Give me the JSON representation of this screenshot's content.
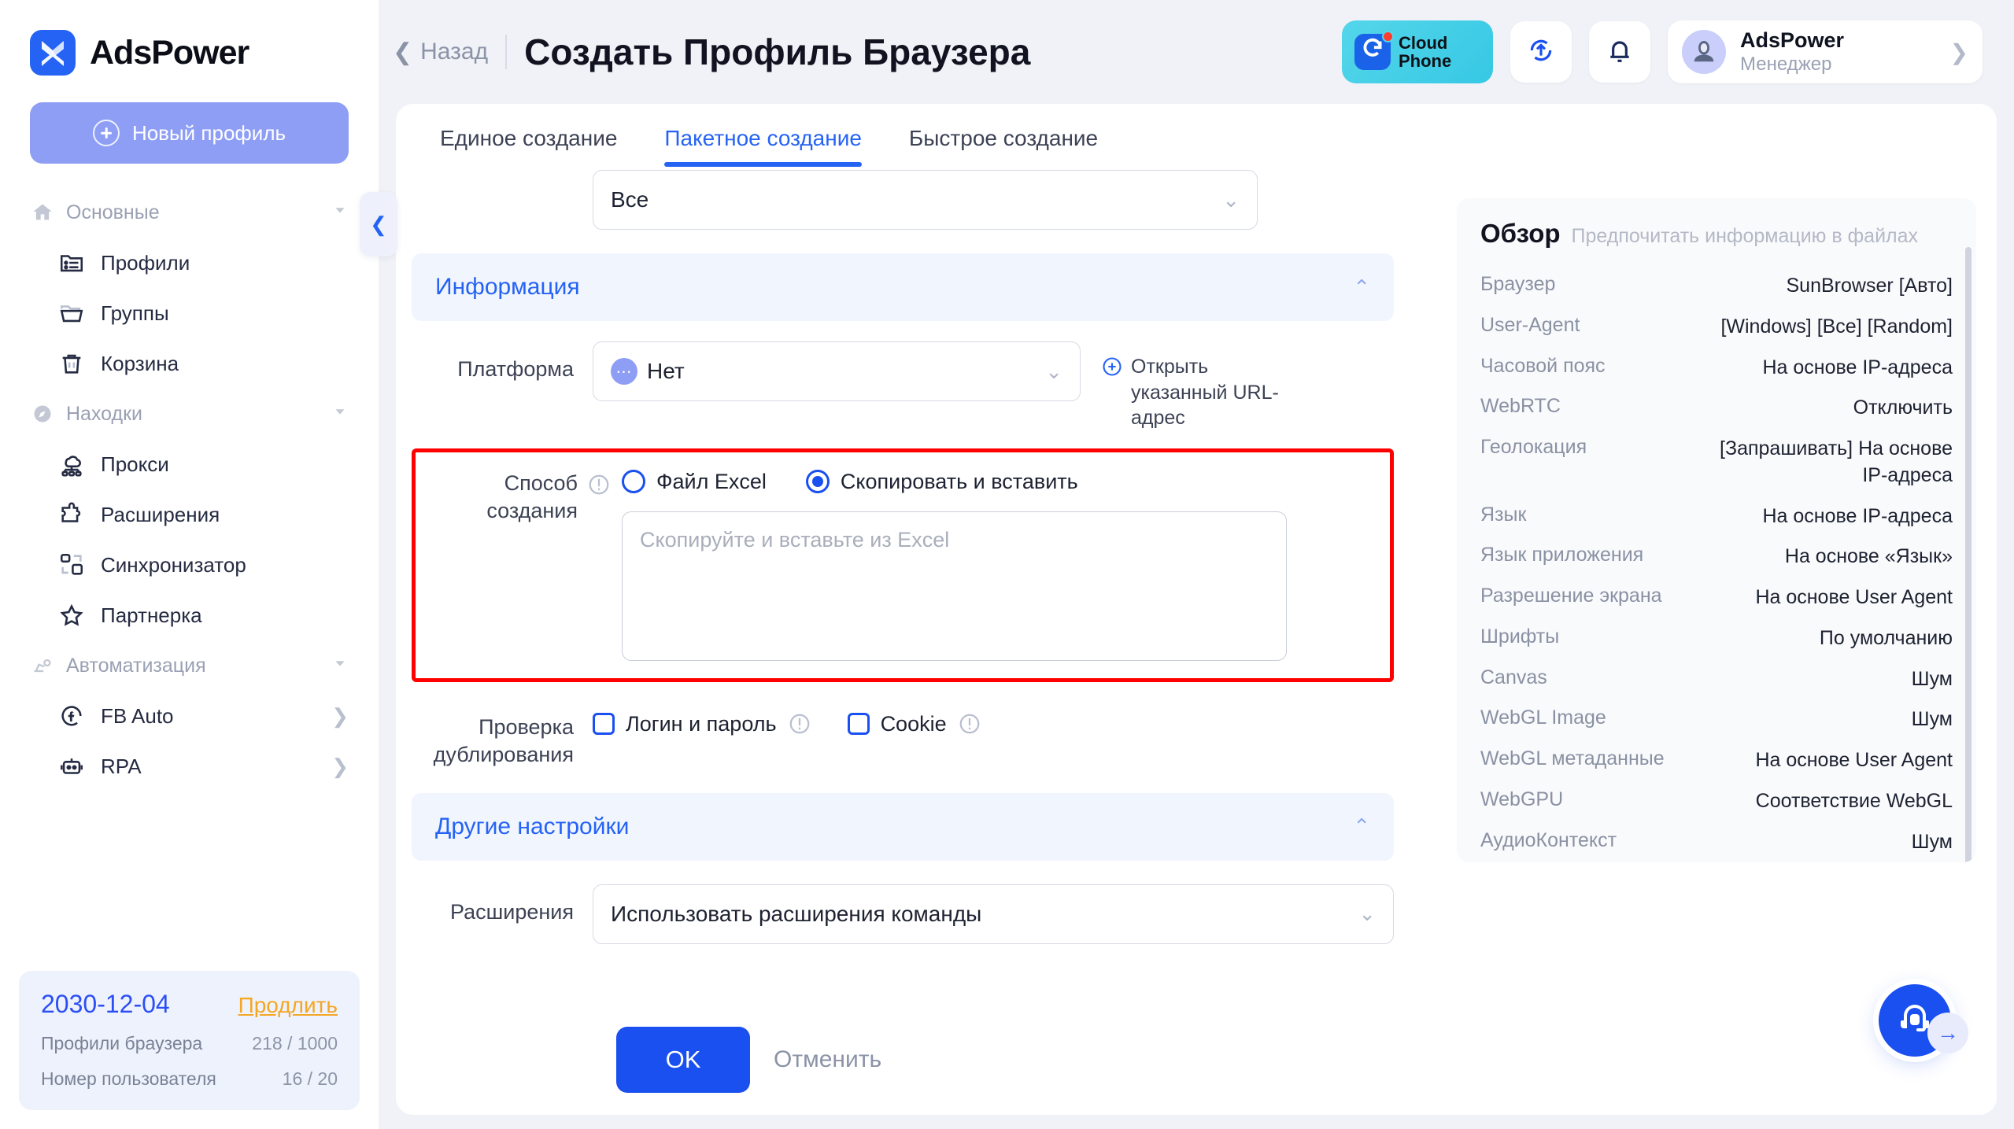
{
  "brand": {
    "name": "AdsPower",
    "logo_icon": "adspower-logo-icon"
  },
  "sidebar": {
    "new_profile_label": "Новый профиль",
    "groups": [
      {
        "label": "Основные",
        "icon": "home-icon",
        "items": [
          {
            "label": "Профили",
            "icon": "folder-list-icon"
          },
          {
            "label": "Группы",
            "icon": "folder-open-icon"
          },
          {
            "label": "Корзина",
            "icon": "trash-icon"
          }
        ]
      },
      {
        "label": "Находки",
        "icon": "compass-icon",
        "items": [
          {
            "label": "Прокси",
            "icon": "proxy-network-icon"
          },
          {
            "label": "Расширения",
            "icon": "puzzle-icon"
          },
          {
            "label": "Синхронизатор",
            "icon": "sync-blocks-icon"
          },
          {
            "label": "Партнерка",
            "icon": "star-icon"
          }
        ]
      },
      {
        "label": "Автоматизация",
        "icon": "robot-arm-icon",
        "items": [
          {
            "label": "FB Auto",
            "icon": "facebook-auto-icon",
            "has_chevron": true
          },
          {
            "label": "RPA",
            "icon": "rpa-robot-icon",
            "has_chevron": true
          }
        ]
      }
    ],
    "account": {
      "expiry_date": "2030-12-04",
      "renew_label": "Продлить",
      "rows": [
        {
          "label": "Профили браузера",
          "value": "218 / 1000"
        },
        {
          "label": "Номер пользователя",
          "value": "16 / 20"
        }
      ]
    }
  },
  "topbar": {
    "back_label": "Назад",
    "title": "Создать Профиль Браузера",
    "cloud_phone": {
      "line1": "Cloud",
      "line2": "Phone"
    },
    "refresh_icon": "refresh-upload-icon",
    "bell_icon": "bell-icon",
    "user": {
      "name": "AdsPower",
      "role": "Менеджер",
      "avatar_icon": "astronaut-avatar-icon"
    }
  },
  "tabs": [
    {
      "label": "Единое создание",
      "active": false
    },
    {
      "label": "Пакетное создание",
      "active": true
    },
    {
      "label": "Быстрое создание",
      "active": false
    }
  ],
  "form": {
    "top_select_value": "Все",
    "section_info": {
      "title": "Информация",
      "collapse_icon": "chevron-up-icon"
    },
    "platform": {
      "label": "Платформа",
      "value": "Нет",
      "badge_icon": "dots-badge-icon",
      "url_link_label": "Открыть указанный URL-адрес",
      "url_link_icon": "plus-circle-icon"
    },
    "creation_method": {
      "label": "Способ создания",
      "info_icon": "info-circle-icon",
      "options": [
        {
          "label": "Файл Excel",
          "selected": false
        },
        {
          "label": "Скопировать и вставить",
          "selected": true
        }
      ],
      "textarea_placeholder": "Скопируйте и вставьте из Excel",
      "textarea_value": ""
    },
    "duplicate_check": {
      "label": "Проверка дублирования",
      "options": [
        {
          "label": "Логин и пароль",
          "checked": false,
          "info_icon": "info-circle-icon"
        },
        {
          "label": "Cookie",
          "checked": false,
          "info_icon": "info-circle-icon"
        }
      ]
    },
    "section_other": {
      "title": "Другие настройки",
      "collapse_icon": "chevron-up-icon"
    },
    "extensions": {
      "label": "Расширения",
      "value": "Использовать расширения команды"
    }
  },
  "overview": {
    "title": "Обзор",
    "subtitle": "Предпочитать информацию в файлах",
    "rows": [
      {
        "key": "Браузер",
        "value": "SunBrowser [Авто]"
      },
      {
        "key": "User-Agent",
        "value": "[Windows] [Все] [Random]"
      },
      {
        "key": "Часовой пояс",
        "value": "На основе IP-адреса"
      },
      {
        "key": "WebRTC",
        "value": "Отключить"
      },
      {
        "key": "Геолокация",
        "value": "[Запрашивать] На основе IP-адреса"
      },
      {
        "key": "Язык",
        "value": "На основе IP-адреса"
      },
      {
        "key": "Язык приложения",
        "value": "На основе «Язык»"
      },
      {
        "key": "Разрешение экрана",
        "value": "На основе User Agent"
      },
      {
        "key": "Шрифты",
        "value": "По умолчанию"
      },
      {
        "key": "Canvas",
        "value": "Шум"
      },
      {
        "key": "WebGL Image",
        "value": "Шум"
      },
      {
        "key": "WebGL метаданные",
        "value": "На основе User Agent"
      },
      {
        "key": "WebGPU",
        "value": "Соответствие WebGL"
      },
      {
        "key": "АудиоКонтекст",
        "value": "Шум"
      }
    ]
  },
  "footer": {
    "ok_label": "OK",
    "cancel_label": "Отменить"
  },
  "support": {
    "icon": "headset-support-icon",
    "arrow_icon": "arrow-right-icon"
  },
  "colors": {
    "accent": "#2563f5",
    "accent_strong": "#1a4ff0",
    "highlight_border": "#ff0000",
    "renew_orange": "#f5a623",
    "section_bg": "#f1f5fe"
  }
}
